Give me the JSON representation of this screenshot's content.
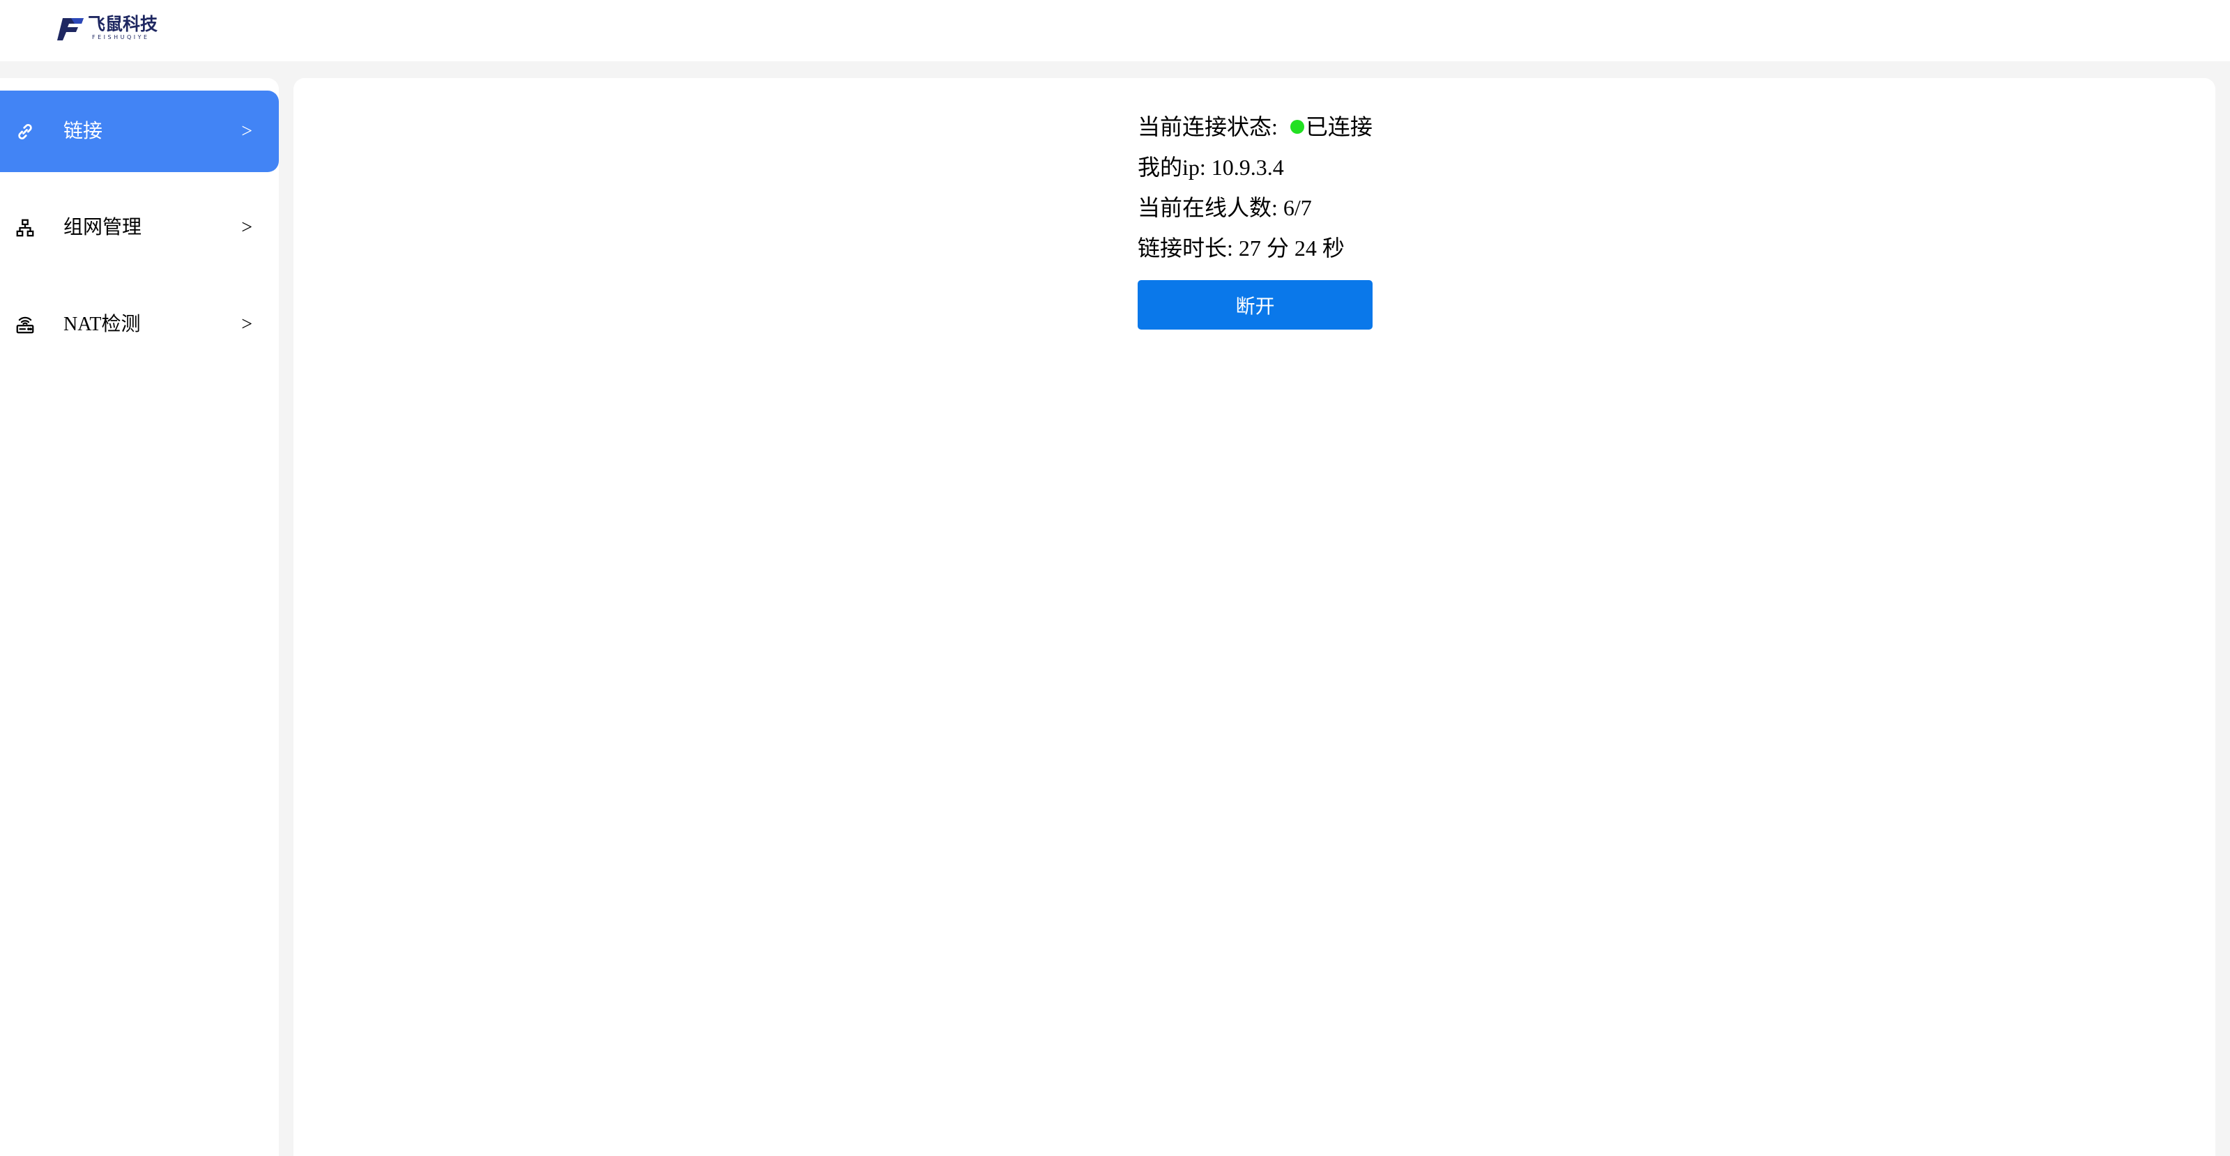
{
  "brand": {
    "name_cn": "飞鼠科技",
    "name_en": "FEISHUQIYE",
    "color": "#1e2761"
  },
  "sidebar": {
    "active_color": "#4284f5",
    "items": [
      {
        "label": "链接",
        "icon": "link-icon",
        "arrow": ">",
        "active": true
      },
      {
        "label": "组网管理",
        "icon": "network-icon",
        "arrow": ">",
        "active": false
      },
      {
        "label": "NAT检测",
        "icon": "router-icon",
        "arrow": ">",
        "active": false
      }
    ]
  },
  "status": {
    "state_label": "当前连接状态:",
    "state_value": "已连接",
    "state_color": "#22e022",
    "ip_label": "我的ip:",
    "ip_value": "10.9.3.4",
    "online_label": "当前在线人数:",
    "online_value": "6/7",
    "duration_label": "链接时长:",
    "duration_value": "27 分 24 秒"
  },
  "actions": {
    "disconnect_label": "断开",
    "disconnect_color": "#0a78ea"
  }
}
